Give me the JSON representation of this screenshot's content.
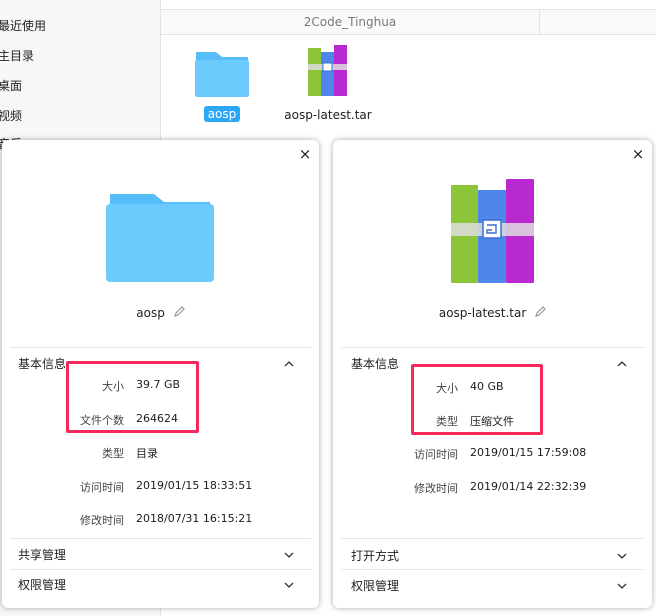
{
  "sidebar": {
    "items": [
      "最近使用",
      "主目录",
      "桌面",
      "视频",
      "音乐"
    ]
  },
  "path_bar": {
    "label": "2Code_Tinghua"
  },
  "files": [
    {
      "name": "aosp",
      "icon": "folder-icon",
      "selected": true
    },
    {
      "name": "aosp-latest.tar",
      "icon": "archive-icon",
      "selected": false
    }
  ],
  "dialog_left": {
    "close": "×",
    "file_name": "aosp",
    "icon": "folder-icon",
    "basic_info_title": "基本信息",
    "properties": [
      {
        "key": "大小",
        "value": "39.7 GB"
      },
      {
        "key": "文件个数",
        "value": "264624"
      },
      {
        "key": "类型",
        "value": "目录"
      },
      {
        "key": "访问时间",
        "value": "2019/01/15 18:33:51"
      },
      {
        "key": "修改时间",
        "value": "2018/07/31 16:15:21"
      }
    ],
    "sections": [
      "共享管理",
      "权限管理"
    ]
  },
  "dialog_right": {
    "close": "×",
    "file_name": "aosp-latest.tar",
    "icon": "archive-icon",
    "basic_info_title": "基本信息",
    "properties": [
      {
        "key": "大小",
        "value": "40 GB"
      },
      {
        "key": "类型",
        "value": "压缩文件"
      },
      {
        "key": "访问时间",
        "value": "2019/01/15 17:59:08"
      },
      {
        "key": "修改时间",
        "value": "2019/01/14 22:32:39"
      }
    ],
    "sections": [
      "打开方式",
      "权限管理"
    ]
  },
  "colors": {
    "selection": "#2ca7f8",
    "highlight": "#f5285a",
    "folder": "#6ccbfc"
  }
}
